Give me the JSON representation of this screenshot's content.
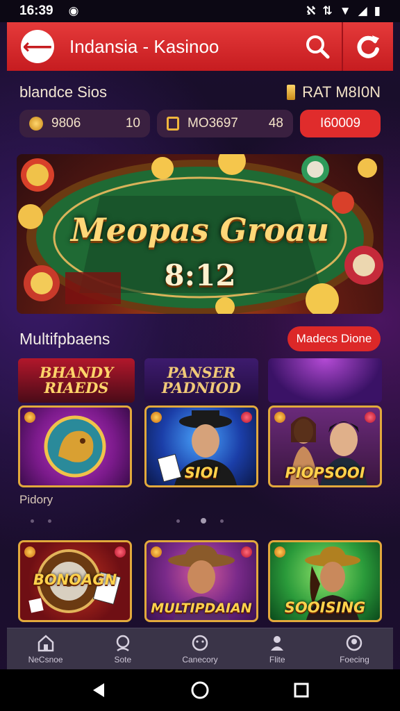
{
  "status_bar": {
    "time": "16:39",
    "left_icon": "notification-circle-icon",
    "right_icons": [
      "signal-icon",
      "data-icon",
      "wifi-icon",
      "cell-icon",
      "battery-icon"
    ]
  },
  "header": {
    "title": "Indansia - Kasinoo",
    "back_icon": "back-arrow-icon",
    "search_icon": "search-icon",
    "bonus_icon": "refresh-bonus-icon",
    "bg_color": "#d42528"
  },
  "balance": {
    "label": "blandce Sios",
    "rate_label": "RAT M8I0N",
    "pill1": {
      "value": "9806",
      "count": "10"
    },
    "pill2": {
      "value": "MO3697",
      "count": "48"
    },
    "cta": "I60009"
  },
  "banner": {
    "title": "Meopas Groau",
    "subtitle": "8:12"
  },
  "section": {
    "title": "Multifpbaens",
    "button": "Madecs Dione"
  },
  "providers": [
    {
      "label": "BHANDY RIAEDS"
    },
    {
      "label": "PANSER PADNIOD"
    },
    {
      "label": ""
    }
  ],
  "games_row1": [
    {
      "label": ""
    },
    {
      "label": "SIOI"
    },
    {
      "label": "PIOPSOOI"
    }
  ],
  "caption": "Pidory",
  "games_row2": [
    {
      "label": "BONOAGN"
    },
    {
      "label": "MULTIPDAIAN"
    },
    {
      "label": "SOOISING"
    }
  ],
  "bottom_nav": [
    {
      "label": "NeCsnoe",
      "icon": "home-icon"
    },
    {
      "label": "Sote",
      "icon": "search-icon"
    },
    {
      "label": "Canecory",
      "icon": "smile-icon"
    },
    {
      "label": "Flite",
      "icon": "user-icon"
    },
    {
      "label": "Foecing",
      "icon": "profile-icon"
    }
  ],
  "accent_color": "#e02c2c",
  "gold_color": "#ffd24c"
}
